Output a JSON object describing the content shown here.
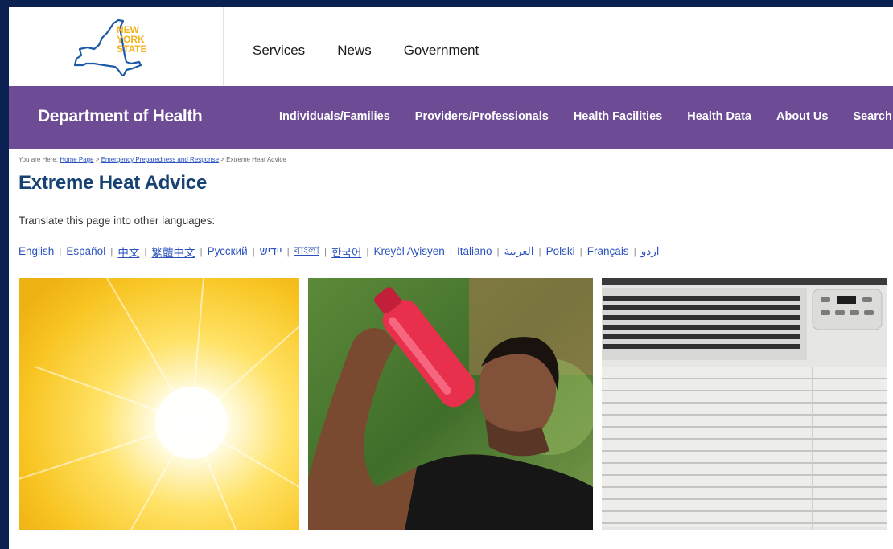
{
  "header": {
    "logo_lines": [
      "NEW",
      "YORK",
      "STATE"
    ],
    "top_nav": [
      "Services",
      "News",
      "Government"
    ]
  },
  "dept_bar": {
    "title": "Department of Health",
    "nav": [
      "Individuals/Families",
      "Providers/Professionals",
      "Health Facilities",
      "Health Data",
      "About Us",
      "Search"
    ]
  },
  "breadcrumb": {
    "prefix": "You are Here:",
    "items": [
      "Home Page",
      "Emergency Preparedness and Response",
      "Extreme Heat Advice"
    ]
  },
  "page": {
    "title": "Extreme Heat Advice",
    "translate_label": "Translate this page into other languages:",
    "languages": [
      "English",
      "Español",
      "中文",
      "繁體中文",
      "Русский",
      "ייִדיש",
      "বাংলা",
      "한국어",
      "Kreyòl Ayisyen",
      "Italiano",
      "العربية",
      "Polski",
      "Français",
      "اردو"
    ]
  },
  "colors": {
    "frame": "#0b2151",
    "purple": "#6e4c95",
    "title": "#154273",
    "link": "#2a52be",
    "logo_gold": "#f2b31b",
    "logo_blue": "#1f5aa6"
  }
}
